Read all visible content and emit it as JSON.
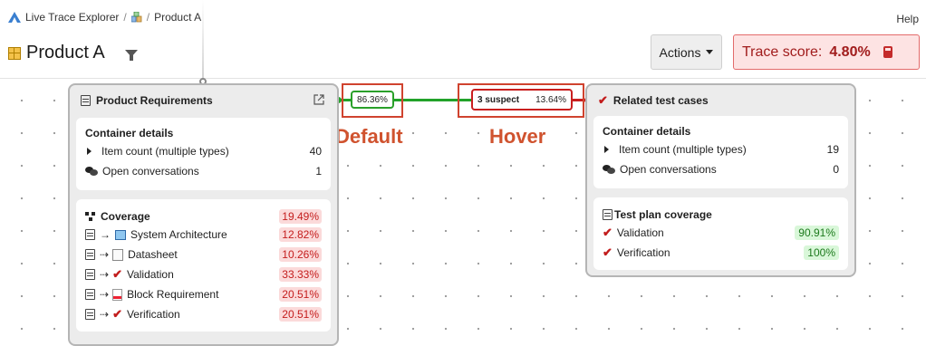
{
  "header": {
    "app_name": "Live Trace Explorer",
    "breadcrumb_sep": "/",
    "project": "Product A",
    "help": "Help",
    "title": "Product A",
    "actions_label": "Actions",
    "trace_score_label": "Trace score:",
    "trace_score_value": "4.80%"
  },
  "left_node": {
    "title": "Product Requirements",
    "container_details": {
      "title": "Container details",
      "rows": [
        {
          "label": "Item count (multiple types)",
          "value": "40"
        },
        {
          "label": "Open conversations",
          "value": "1"
        }
      ]
    },
    "coverage": {
      "title": "Coverage",
      "total": "19.49%",
      "rows": [
        {
          "label": "System Architecture",
          "value": "12.82%"
        },
        {
          "label": "Datasheet",
          "value": "10.26%"
        },
        {
          "label": "Validation",
          "value": "33.33%"
        },
        {
          "label": "Block Requirement",
          "value": "20.51%"
        },
        {
          "label": "Verification",
          "value": "20.51%"
        }
      ]
    }
  },
  "edge": {
    "default_value": "86.36%",
    "hover_suspect": "3 suspect",
    "hover_value": "13.64%"
  },
  "annotations": {
    "default": "Default",
    "hover": "Hover"
  },
  "right_node": {
    "title": "Related test cases",
    "container_details": {
      "title": "Container details",
      "rows": [
        {
          "label": "Item count (multiple types)",
          "value": "19"
        },
        {
          "label": "Open conversations",
          "value": "0"
        }
      ]
    },
    "test_plan": {
      "title": "Test plan coverage",
      "rows": [
        {
          "label": "Validation",
          "value": "90.91%"
        },
        {
          "label": "Verification",
          "value": "100%"
        }
      ]
    }
  },
  "colors": {
    "accent_red": "#c21d1d",
    "edge_green": "#22a22a",
    "annotation": "#d0432f"
  }
}
